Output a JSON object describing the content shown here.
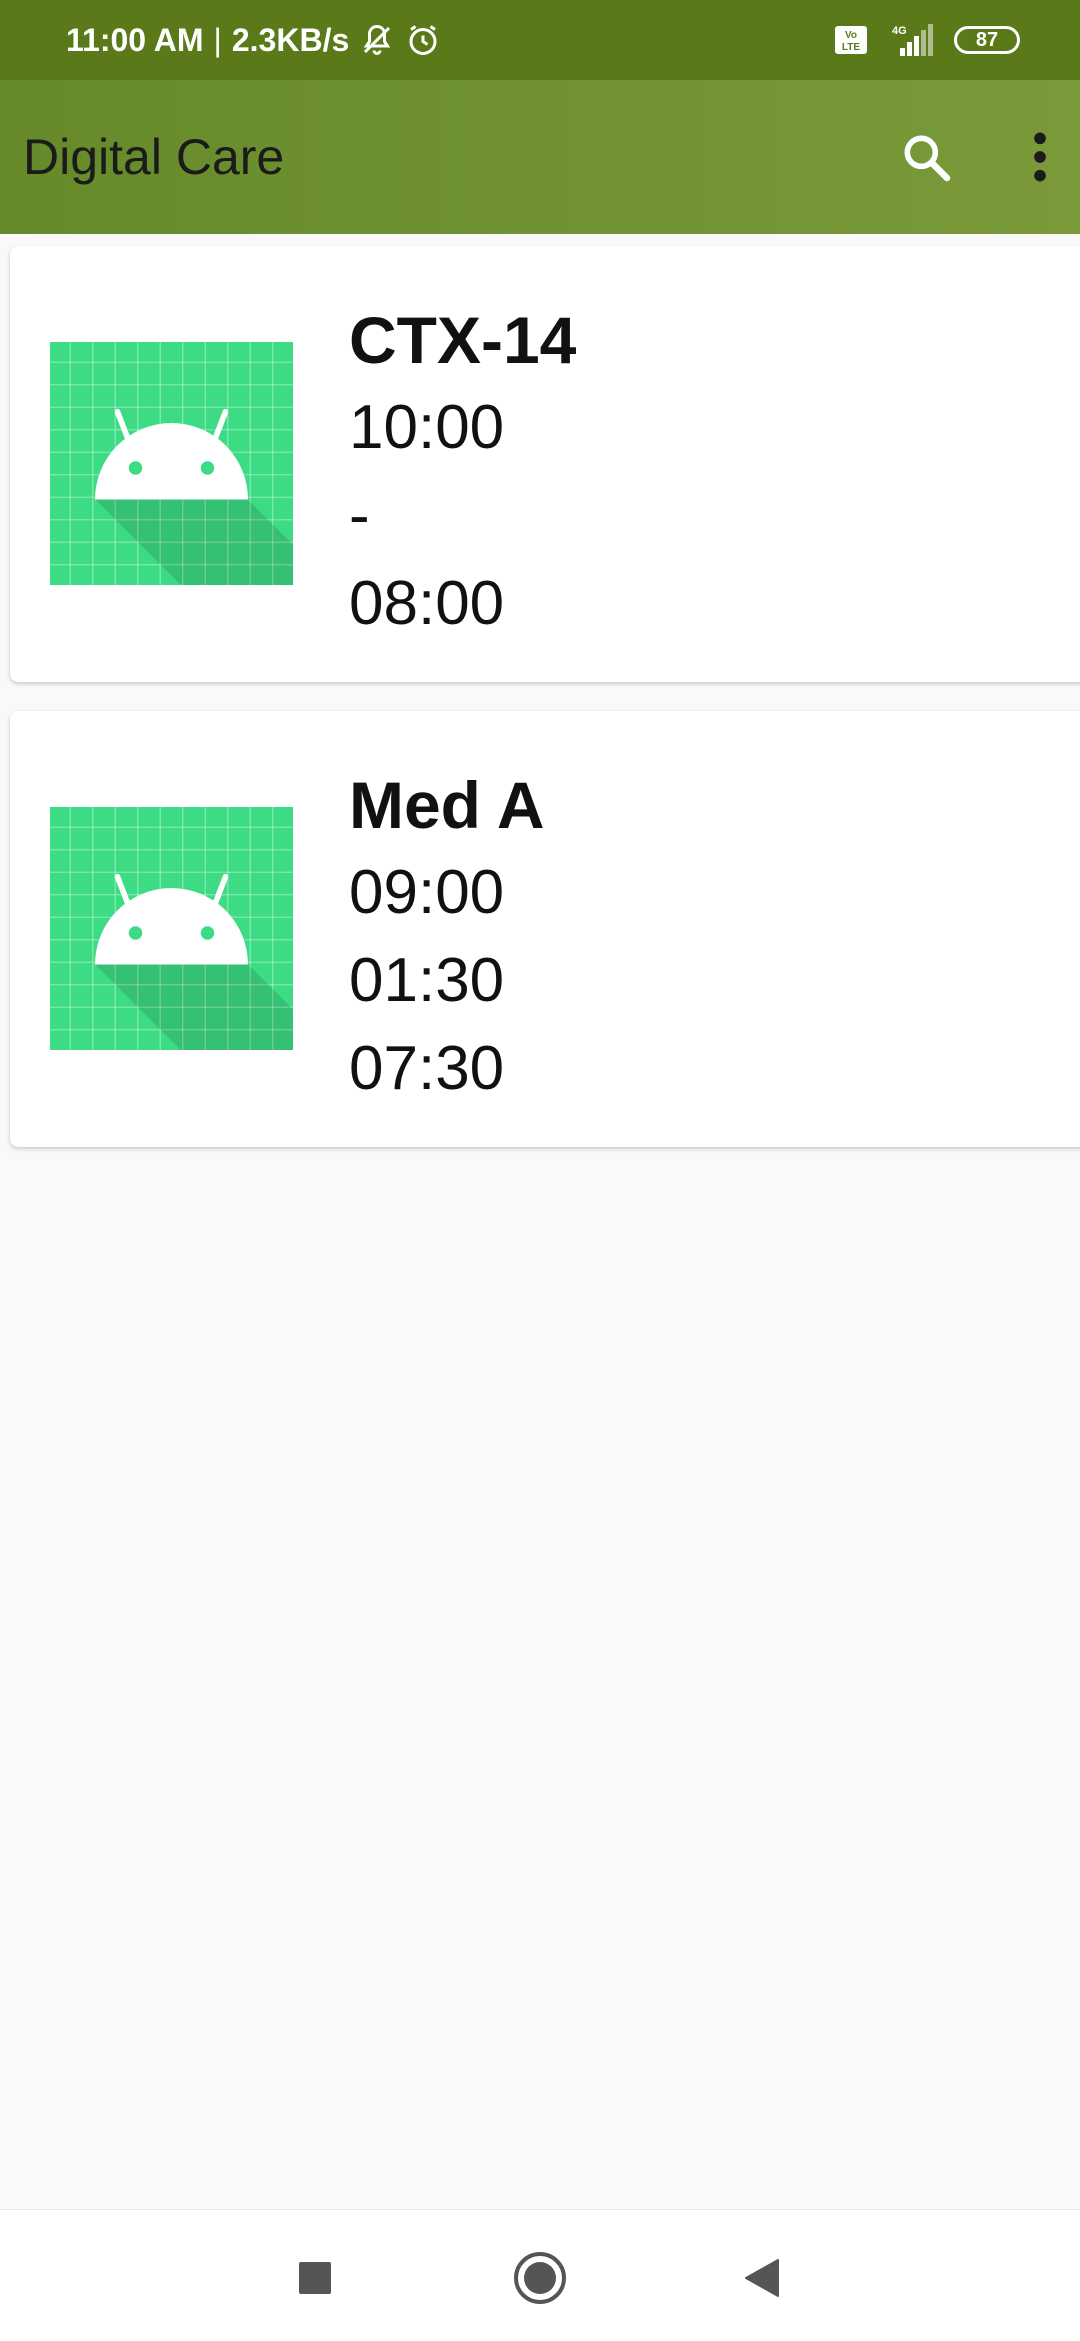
{
  "status_bar": {
    "time": "11:00 AM",
    "separator": "|",
    "network_speed": "2.3KB/s",
    "icons": [
      "mute-notifications-icon",
      "alarm-icon",
      "volte-icon",
      "signal-4g-icon"
    ],
    "signal_label": "4G",
    "volte_label": "Vo LTE",
    "battery": "87"
  },
  "app_bar": {
    "title": "Digital Care",
    "actions": [
      "search-icon",
      "more-vert-icon"
    ],
    "background": "#6f8f30"
  },
  "medications": [
    {
      "name": "CTX-14",
      "lines": [
        "10:00",
        "-",
        "08:00"
      ],
      "thumbnail": "android-placeholder-icon"
    },
    {
      "name": "Med A",
      "lines": [
        "09:00",
        "01:30",
        "07:30"
      ],
      "thumbnail": "android-placeholder-icon"
    }
  ],
  "nav_bar": {
    "buttons": [
      "recents-square-icon",
      "home-circle-icon",
      "back-triangle-icon"
    ]
  },
  "colors": {
    "status_bar": "#5a7a1a",
    "app_bar": "#6f8f30",
    "thumbnail_green": "#3ddc84",
    "background": "#f9f9f9"
  }
}
